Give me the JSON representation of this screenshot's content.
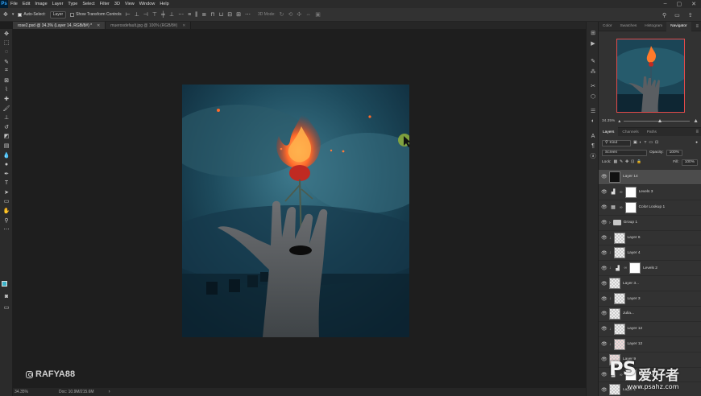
{
  "app": {
    "logo": "Ps"
  },
  "menu": [
    "File",
    "Edit",
    "Image",
    "Layer",
    "Type",
    "Select",
    "Filter",
    "3D",
    "View",
    "Window",
    "Help"
  ],
  "options_bar": {
    "auto_select_label": "Auto-Select:",
    "auto_select_value": "Layer",
    "transform_label": "Show Transform Controls",
    "mode_3d_label": "3D Mode:"
  },
  "tabs": [
    {
      "label": "rose2.psd @ 34.3% (Layer 14, RGB/8#) *",
      "active": true
    },
    {
      "label": "muerosdefault.jpg @ 100% (RGB/8#)",
      "active": false
    }
  ],
  "status": {
    "zoom": "34.35%",
    "doc": "Doc: 10.9M/215.6M"
  },
  "watermark": {
    "handle": "RAFYA88"
  },
  "navigator": {
    "tabs": [
      "Color",
      "Swatches",
      "Histogram",
      "Navigator"
    ],
    "active_tab": "Navigator",
    "zoom": "34.35%"
  },
  "layers_panel": {
    "tabs": [
      "Layers",
      "Channels",
      "Paths"
    ],
    "active_tab": "Layers",
    "filter_kind": "Kind",
    "blend_mode": "Screen",
    "opacity_label": "Opacity:",
    "opacity_value": "100%",
    "lock_label": "Lock:",
    "fill_label": "Fill:",
    "fill_value": "100%",
    "layers": [
      {
        "name": "Layer 14",
        "type": "pixel",
        "thumb": "dark",
        "selected": true
      },
      {
        "name": "Levels 3",
        "type": "levels",
        "thumb": "white"
      },
      {
        "name": "Color Lookup 1",
        "type": "lookup",
        "thumb": "white"
      },
      {
        "name": "Group 1",
        "type": "group"
      },
      {
        "name": "Layer 6",
        "type": "pixel",
        "thumb": "checker"
      },
      {
        "name": "Layer 4",
        "type": "pixel",
        "thumb": "checker"
      },
      {
        "name": "Levels 2",
        "type": "levels",
        "thumb": "white"
      },
      {
        "name": "Layer 3...",
        "type": "pixel",
        "thumb": "checker"
      },
      {
        "name": "Layer 3",
        "type": "pixel",
        "thumb": "checker"
      },
      {
        "name": "Julia...",
        "type": "pixel",
        "thumb": "checker"
      },
      {
        "name": "Layer 12",
        "type": "pixel",
        "thumb": "checker"
      },
      {
        "name": "Layer 12",
        "type": "pixel",
        "thumb": "pink"
      },
      {
        "name": "Layer 9",
        "type": "pixel",
        "thumb": "pink"
      },
      {
        "name": "Levels 1",
        "type": "levels",
        "thumb": "white"
      },
      {
        "name": "Layer 1",
        "type": "pixel",
        "thumb": "checker"
      }
    ]
  },
  "site_watermark": {
    "ps": "PS",
    "cn": "爱好者",
    "url": "www.psahz.com"
  },
  "colors": {
    "foreground": "#3bb3c9",
    "background": "#ffffff",
    "accent": "#31a8ff"
  }
}
